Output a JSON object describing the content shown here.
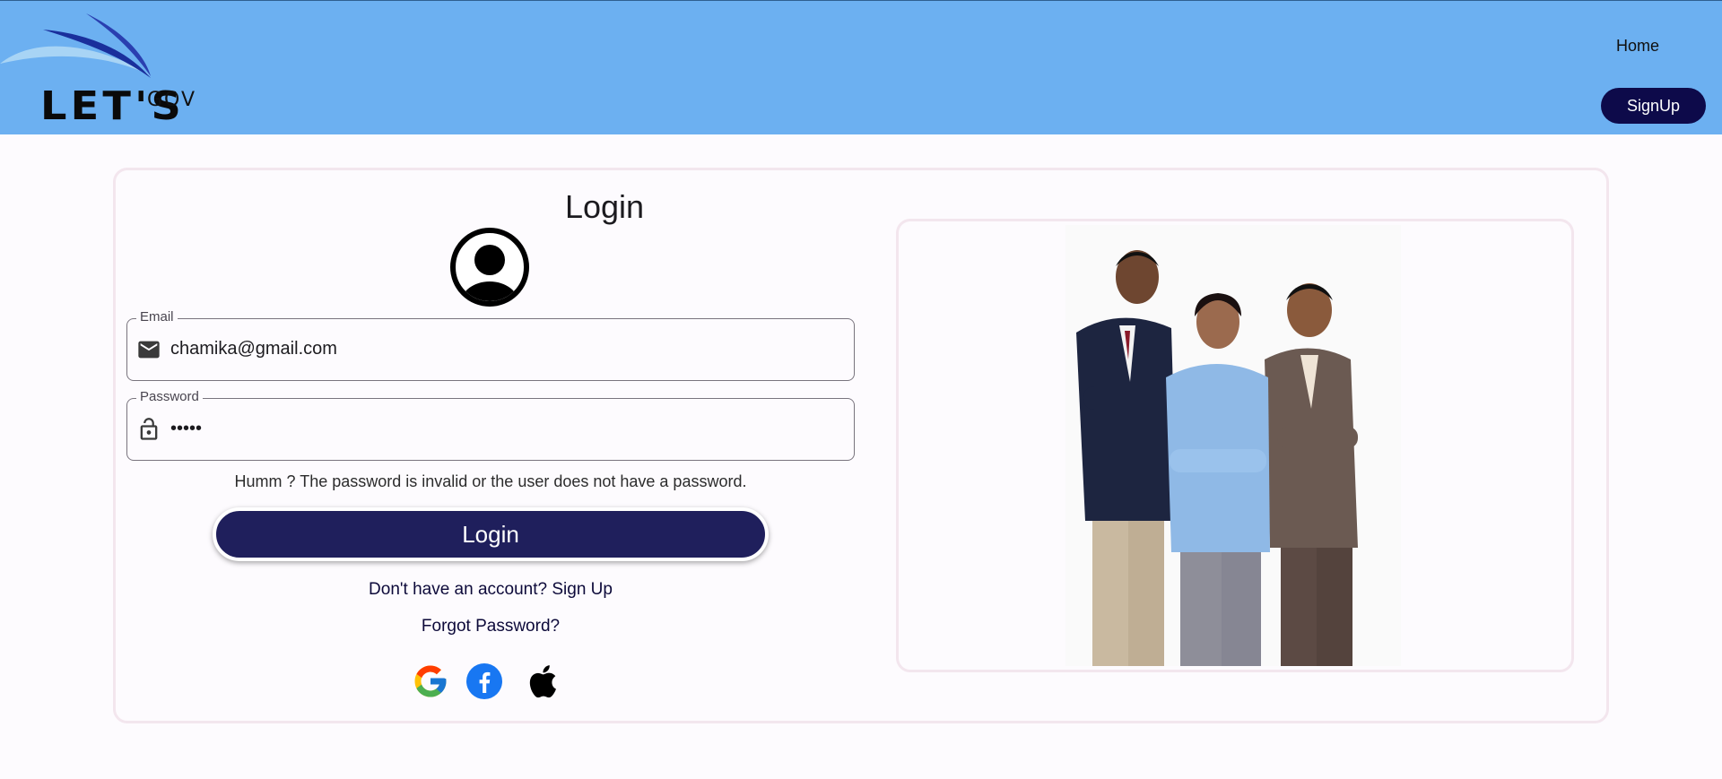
{
  "header": {
    "logo_text": "LET'S",
    "logo_sub": "GOV",
    "nav_home": "Home",
    "nav_signup": "SignUp"
  },
  "login": {
    "title": "Login",
    "email": {
      "label": "Email",
      "value": "chamika@gmail.com"
    },
    "password": {
      "label": "Password",
      "value": "•••••"
    },
    "error": "Humm ? The password is invalid or the user does not have a password.",
    "button": "Login",
    "signup_link": "Don't have an account? Sign Up",
    "forgot_link": "Forgot Password?",
    "social": [
      "google-icon",
      "facebook-icon",
      "apple-icon"
    ]
  },
  "colors": {
    "header_bg": "#6cb0f1",
    "primary_dark": "#1f1f5c",
    "nav_button": "#0d0a4a",
    "card_border": "#f3e6ee"
  }
}
